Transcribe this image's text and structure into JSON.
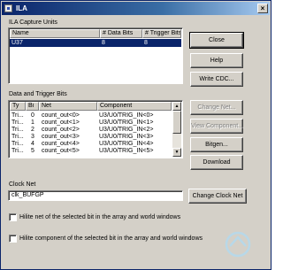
{
  "window": {
    "title": "ILA",
    "close_glyph": "×"
  },
  "capture_units": {
    "section_label": "ILA Capture Units",
    "columns": [
      "Name",
      "# Data Bits",
      "# Trigger Bits"
    ],
    "rows": [
      {
        "name": "U37",
        "data_bits": "8",
        "trigger_bits": "8"
      }
    ]
  },
  "buttons": {
    "close": "Close",
    "help": "Help",
    "write_cdc": "Write CDC...",
    "change_net": "Change Net...",
    "view_component": "View Component...",
    "bitgen": "Bitgen...",
    "download": "Download",
    "change_clock_net": "Change Clock Net"
  },
  "data_trigger": {
    "section_label": "Data and Trigger Bits",
    "columns": [
      "Ty",
      "Bi",
      "Net",
      "Component"
    ],
    "rows": [
      {
        "type": "Tri...",
        "bit": "0",
        "net": "count_out<0>",
        "component": "U3/U0/TRIG_IN<0>"
      },
      {
        "type": "Tri...",
        "bit": "1",
        "net": "count_out<1>",
        "component": "U3/U0/TRIG_IN<1>"
      },
      {
        "type": "Tri...",
        "bit": "2",
        "net": "count_out<2>",
        "component": "U3/U0/TRIG_IN<2>"
      },
      {
        "type": "Tri...",
        "bit": "3",
        "net": "count_out<3>",
        "component": "U3/U0/TRIG_IN<3>"
      },
      {
        "type": "Tri...",
        "bit": "4",
        "net": "count_out<4>",
        "component": "U3/U0/TRIG_IN<4>"
      },
      {
        "type": "Tri...",
        "bit": "5",
        "net": "count_out<5>",
        "component": "U3/U0/TRIG_IN<5>"
      }
    ]
  },
  "clock": {
    "label": "Clock Net",
    "value": "clk_BUFGP"
  },
  "options": {
    "hilite_net": "Hilite net of the selected bit in the array and world windows",
    "hilite_component": "Hilite component of the selected bit in the array and world windows"
  },
  "icons": [
    "app-icon",
    "close-icon",
    "scroll-up-icon",
    "scroll-down-icon",
    "watermark-logo"
  ]
}
